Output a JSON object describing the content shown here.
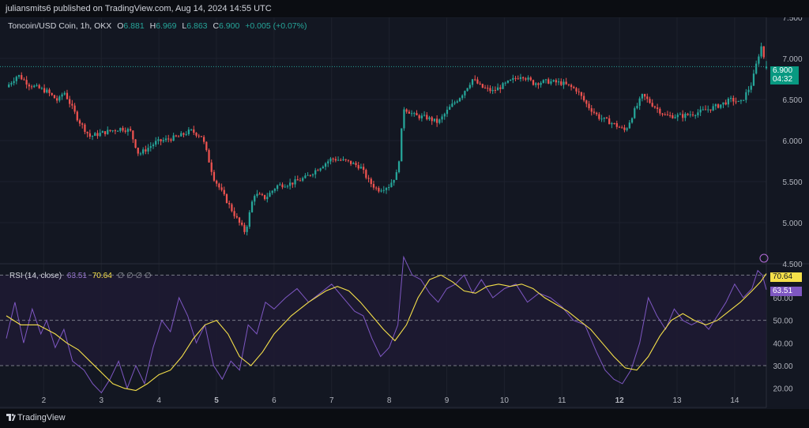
{
  "header": {
    "publish_text": "juliansmits6 published on TradingView.com, Aug 14, 2024 14:55 UTC"
  },
  "legend": {
    "symbol": "Toncoin/USD Coin, 1h, OKX",
    "o_label": "O",
    "o_value": "6.881",
    "h_label": "H",
    "h_value": "6.969",
    "l_label": "L",
    "l_value": "6.863",
    "c_label": "C",
    "c_value": "6.900",
    "change": "+0.005 (+0.07%)"
  },
  "rsi_legend": {
    "label": "RSI (14, close)",
    "rsi_value": "63.51",
    "ma_value": "70.64",
    "hidden_markers": "∅ ∅ ∅ ∅"
  },
  "price_tag": {
    "price": "6.900",
    "countdown": "04:32"
  },
  "rsi_tags": {
    "ma": "70.64",
    "rsi": "63.51"
  },
  "footer": {
    "brand": "TradingView"
  },
  "colors": {
    "background": "#131722",
    "up": "#26a69a",
    "down": "#ef5350",
    "rsi_line": "#7e57c2",
    "rsi_ma": "#f5e04a",
    "rsi_band": "#1f1a33",
    "grid": "#1e222d"
  },
  "chart_data": [
    {
      "type": "candlestick",
      "title": "Toncoin/USD Coin, 1h, OKX",
      "ylim": [
        4.5,
        7.5
      ],
      "y_ticks": [
        "7.500",
        "7.000",
        "6.500",
        "6.000",
        "5.500",
        "5.000",
        "4.500"
      ],
      "x_ticks": [
        "2",
        "3",
        "4",
        "5",
        "6",
        "7",
        "8",
        "9",
        "10",
        "11",
        "12",
        "13",
        "14"
      ],
      "x_range_days": [
        1.35,
        14.55
      ],
      "anchors": [
        [
          1.35,
          6.65
        ],
        [
          1.55,
          6.8
        ],
        [
          1.75,
          6.68
        ],
        [
          2.05,
          6.6
        ],
        [
          2.25,
          6.48
        ],
        [
          2.35,
          6.6
        ],
        [
          2.6,
          6.25
        ],
        [
          2.8,
          6.05
        ],
        [
          3.05,
          6.1
        ],
        [
          3.35,
          6.15
        ],
        [
          3.5,
          6.12
        ],
        [
          3.65,
          5.83
        ],
        [
          3.95,
          5.98
        ],
        [
          4.35,
          6.05
        ],
        [
          4.55,
          6.12
        ],
        [
          4.75,
          6.05
        ],
        [
          4.95,
          5.55
        ],
        [
          5.15,
          5.3
        ],
        [
          5.35,
          5.05
        ],
        [
          5.5,
          4.88
        ],
        [
          5.65,
          5.35
        ],
        [
          5.85,
          5.3
        ],
        [
          6.05,
          5.45
        ],
        [
          6.3,
          5.48
        ],
        [
          6.55,
          5.55
        ],
        [
          6.8,
          5.68
        ],
        [
          7.0,
          5.78
        ],
        [
          7.25,
          5.75
        ],
        [
          7.5,
          5.68
        ],
        [
          7.65,
          5.5
        ],
        [
          7.8,
          5.4
        ],
        [
          8.0,
          5.45
        ],
        [
          8.15,
          5.62
        ],
        [
          8.25,
          6.4
        ],
        [
          8.45,
          6.3
        ],
        [
          8.65,
          6.28
        ],
        [
          8.85,
          6.22
        ],
        [
          9.05,
          6.4
        ],
        [
          9.25,
          6.55
        ],
        [
          9.45,
          6.75
        ],
        [
          9.6,
          6.65
        ],
        [
          9.8,
          6.6
        ],
        [
          10.05,
          6.7
        ],
        [
          10.3,
          6.8
        ],
        [
          10.5,
          6.7
        ],
        [
          10.75,
          6.72
        ],
        [
          11.0,
          6.7
        ],
        [
          11.25,
          6.62
        ],
        [
          11.45,
          6.42
        ],
        [
          11.65,
          6.28
        ],
        [
          11.85,
          6.22
        ],
        [
          12.1,
          6.12
        ],
        [
          12.25,
          6.35
        ],
        [
          12.4,
          6.55
        ],
        [
          12.6,
          6.42
        ],
        [
          12.8,
          6.3
        ],
        [
          13.1,
          6.3
        ],
        [
          13.4,
          6.35
        ],
        [
          13.7,
          6.42
        ],
        [
          13.95,
          6.5
        ],
        [
          14.1,
          6.45
        ],
        [
          14.3,
          6.7
        ],
        [
          14.4,
          7.0
        ],
        [
          14.46,
          7.15
        ],
        [
          14.55,
          6.9
        ]
      ],
      "last": {
        "open": 6.881,
        "high": 6.969,
        "low": 6.863,
        "close": 6.9
      }
    },
    {
      "type": "line",
      "title": "RSI (14, close)",
      "ylim": [
        15,
        75
      ],
      "y_ticks": [
        "60.00",
        "50.00",
        "40.00",
        "30.00",
        "20.00"
      ],
      "bands": [
        30,
        50,
        70
      ],
      "series": [
        {
          "name": "RSI",
          "x": [
            1.35,
            1.5,
            1.65,
            1.8,
            1.95,
            2.05,
            2.2,
            2.35,
            2.5,
            2.7,
            2.85,
            3.0,
            3.15,
            3.3,
            3.45,
            3.6,
            3.75,
            3.9,
            4.05,
            4.2,
            4.35,
            4.5,
            4.65,
            4.8,
            4.95,
            5.1,
            5.25,
            5.4,
            5.55,
            5.7,
            5.85,
            6.0,
            6.2,
            6.4,
            6.6,
            6.8,
            7.0,
            7.2,
            7.4,
            7.55,
            7.7,
            7.85,
            8.0,
            8.15,
            8.25,
            8.4,
            8.55,
            8.7,
            8.85,
            9.0,
            9.15,
            9.3,
            9.45,
            9.6,
            9.8,
            10.0,
            10.2,
            10.4,
            10.6,
            10.8,
            11.0,
            11.2,
            11.4,
            11.6,
            11.75,
            11.9,
            12.05,
            12.2,
            12.35,
            12.5,
            12.65,
            12.8,
            12.95,
            13.1,
            13.25,
            13.4,
            13.55,
            13.7,
            13.85,
            14.0,
            14.15,
            14.3,
            14.4,
            14.48,
            14.55
          ],
          "values": [
            42,
            58,
            40,
            55,
            44,
            50,
            38,
            46,
            32,
            28,
            22,
            18,
            24,
            32,
            20,
            30,
            22,
            38,
            50,
            45,
            60,
            52,
            40,
            48,
            30,
            24,
            32,
            28,
            48,
            44,
            58,
            55,
            60,
            64,
            58,
            62,
            66,
            60,
            54,
            52,
            42,
            34,
            38,
            48,
            78,
            70,
            68,
            62,
            58,
            64,
            66,
            70,
            62,
            68,
            60,
            64,
            66,
            58,
            62,
            60,
            56,
            50,
            48,
            36,
            28,
            24,
            22,
            28,
            40,
            60,
            52,
            46,
            55,
            50,
            48,
            50,
            46,
            52,
            58,
            66,
            60,
            64,
            72,
            70,
            63.51
          ]
        },
        {
          "name": "RSI-based MA",
          "x": [
            1.35,
            1.6,
            1.9,
            2.2,
            2.4,
            2.6,
            2.8,
            3.0,
            3.2,
            3.4,
            3.6,
            3.8,
            4.0,
            4.2,
            4.4,
            4.6,
            4.8,
            5.0,
            5.2,
            5.4,
            5.6,
            5.8,
            6.0,
            6.3,
            6.6,
            6.9,
            7.1,
            7.3,
            7.5,
            7.7,
            7.9,
            8.1,
            8.3,
            8.5,
            8.7,
            8.9,
            9.1,
            9.3,
            9.5,
            9.7,
            9.9,
            10.1,
            10.3,
            10.5,
            10.7,
            10.9,
            11.1,
            11.3,
            11.5,
            11.7,
            11.9,
            12.1,
            12.3,
            12.5,
            12.7,
            12.9,
            13.1,
            13.3,
            13.5,
            13.7,
            13.9,
            14.1,
            14.3,
            14.45,
            14.55
          ],
          "values": [
            52,
            48,
            48,
            44,
            40,
            37,
            32,
            27,
            22,
            20,
            19,
            22,
            26,
            28,
            34,
            42,
            48,
            50,
            44,
            34,
            30,
            36,
            44,
            52,
            58,
            63,
            65,
            63,
            58,
            52,
            46,
            41,
            48,
            60,
            68,
            70,
            67,
            63,
            62,
            65,
            66,
            65,
            66,
            64,
            60,
            57,
            54,
            50,
            46,
            40,
            34,
            29,
            28,
            34,
            43,
            50,
            53,
            50,
            48,
            50,
            54,
            58,
            63,
            67,
            70.64
          ]
        }
      ]
    }
  ]
}
